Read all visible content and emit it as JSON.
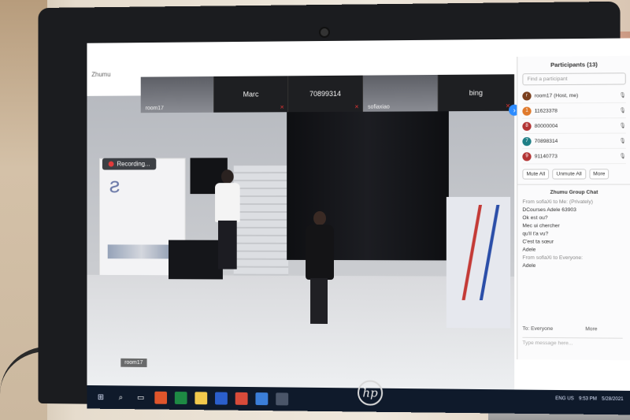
{
  "zoom": {
    "app_title": "Zhumu",
    "recording_label": "Recording...",
    "active_speaker": "room17",
    "thumbnails": [
      {
        "label": "room17",
        "type": "video"
      },
      {
        "label": "Marc",
        "type": "name"
      },
      {
        "label": "70899314",
        "type": "name"
      },
      {
        "label": "sofiaxiao",
        "type": "video"
      },
      {
        "label": "bing",
        "type": "name"
      }
    ],
    "participants_panel": {
      "title": "Participants (13)",
      "search_placeholder": "Find a participant",
      "list": [
        {
          "initial": "r",
          "name": "room17 (Host, me)",
          "color": "#7b3f1e"
        },
        {
          "initial": "1",
          "name": "11623378",
          "color": "#e07a2c"
        },
        {
          "initial": "8",
          "name": "80000004",
          "color": "#b33434"
        },
        {
          "initial": "7",
          "name": "70898314",
          "color": "#1f7f86"
        },
        {
          "initial": "9",
          "name": "91140773",
          "color": "#b33434"
        }
      ],
      "buttons": [
        "Mute All",
        "Unmute All",
        "More"
      ]
    },
    "chat_panel": {
      "title": "Zhumu Group Chat",
      "messages": [
        {
          "from": "From sofiaXi to Me: (Privately)",
          "lines": [
            "DCourses Adele 63903",
            "Ok est ou?",
            "Mec ui chercher",
            "qu'il t'a vu?",
            "C'est ta sœur",
            "Adele"
          ]
        },
        {
          "from": "From sofiaXi to Everyone:",
          "lines": [
            "Adele"
          ]
        }
      ],
      "more_label": "More",
      "to_label": "To: Everyone",
      "input_placeholder": "Type message here..."
    }
  },
  "taskbar": {
    "tray_lang": "ENG US",
    "time": "9:53 PM",
    "date": "5/28/2021"
  },
  "laptop": {
    "brand": "hp"
  }
}
